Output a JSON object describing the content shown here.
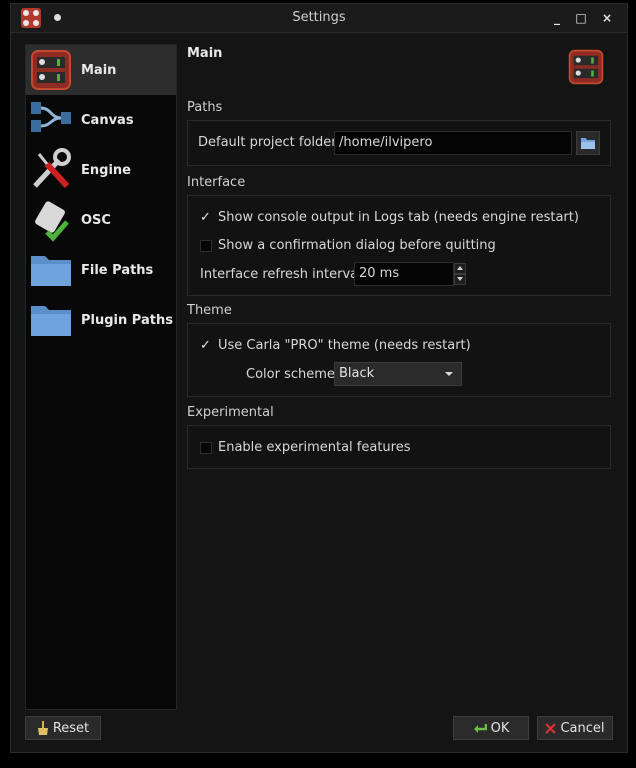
{
  "window": {
    "title": "Settings",
    "controls": {
      "minimize": "_",
      "maximize": "□",
      "close": "×"
    }
  },
  "sidebar": {
    "items": [
      {
        "label": "Main",
        "icon": "main-app-icon",
        "active": true
      },
      {
        "label": "Canvas",
        "icon": "canvas-icon",
        "active": false
      },
      {
        "label": "Engine",
        "icon": "engine-tools-icon",
        "active": false
      },
      {
        "label": "OSC",
        "icon": "osc-plugin-icon",
        "active": false
      },
      {
        "label": "File Paths",
        "icon": "folder-icon",
        "active": false
      },
      {
        "label": "Plugin Paths",
        "icon": "folder-icon",
        "active": false
      }
    ]
  },
  "main": {
    "title": "Main",
    "paths": {
      "section_title": "Paths",
      "default_folder_label": "Default project folder:",
      "default_folder_value": "/home/ilvipero"
    },
    "interface": {
      "section_title": "Interface",
      "show_console_label": "Show console output in Logs tab (needs engine restart)",
      "show_console_checked": true,
      "confirm_quit_label": "Show a confirmation dialog before quitting",
      "confirm_quit_checked": false,
      "refresh_label": "Interface refresh interval:",
      "refresh_value": "20 ms"
    },
    "theme": {
      "section_title": "Theme",
      "use_pro_label": "Use Carla \"PRO\" theme (needs restart)",
      "use_pro_checked": true,
      "color_scheme_label": "Color scheme:",
      "color_scheme_value": "Black"
    },
    "experimental": {
      "section_title": "Experimental",
      "enable_label": "Enable experimental features",
      "enable_checked": false
    }
  },
  "footer": {
    "reset_label": "Reset",
    "ok_label": "OK",
    "cancel_label": "Cancel"
  },
  "colors": {
    "background": "#141414",
    "sidebar_bg": "#080808",
    "sidebar_active": "#2d2d2d",
    "accent_red": "#b13a2f",
    "check_green": "#56a33a"
  }
}
